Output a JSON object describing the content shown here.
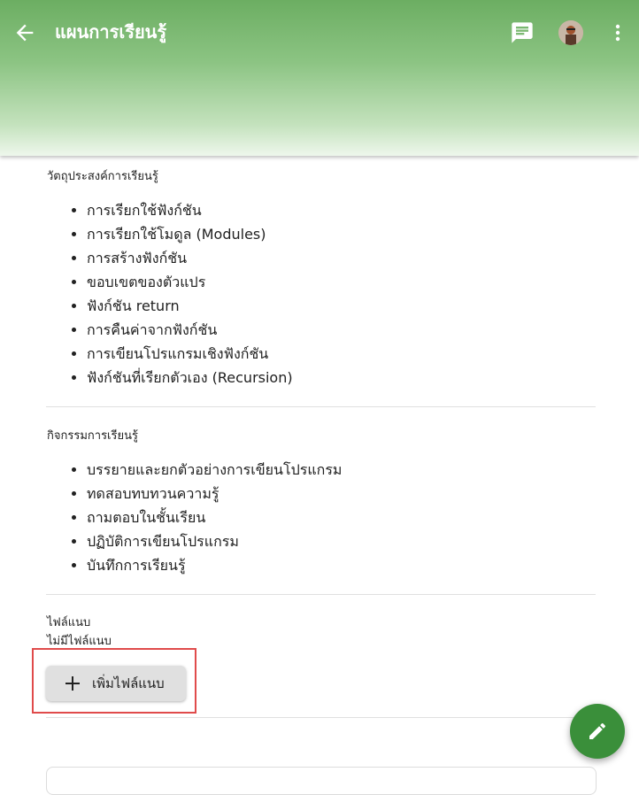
{
  "header": {
    "title": "แผนการเรียนรู้",
    "back_icon": "arrow-back-icon",
    "chat_icon": "chat-icon",
    "more_icon": "more-vert-icon",
    "gradient_top": "#6cae62",
    "gradient_bottom": "#eef7ec"
  },
  "objectives": {
    "label": "วัตถุประสงค์การเรียนรู้",
    "items": [
      "การเรียกใช้ฟังก์ชัน",
      "การเรียกใช้โมดูล (Modules)",
      "การสร้างฟังก์ชัน",
      "ขอบเขตของตัวแปร",
      "ฟังก์ชัน return",
      "การคืนค่าจากฟังก์ชัน",
      "การเขียนโปรแกรมเชิงฟังก์ชัน",
      "ฟังก์ชันที่เรียกตัวเอง (Recursion)"
    ]
  },
  "activities": {
    "label": "กิจกรรมการเรียนรู้",
    "items": [
      "บรรยายและยกตัวอย่างการเขียนโปรแกรม",
      "ทดสอบทบทวนความรู้",
      "ถามตอบในชั้นเรียน",
      "ปฏิบัติการเขียนโปรแกรม",
      "บันทึกการเรียนรู้"
    ]
  },
  "attachments": {
    "label": "ไฟล์แนบ",
    "empty_text": "ไม่มีไฟล์แนบ",
    "add_button_label": "เพิ่มไฟล์แนบ",
    "add_icon": "plus-icon"
  },
  "fab": {
    "icon": "pencil-icon",
    "color": "#3a8f3a"
  },
  "highlight_color": "#e04b4b"
}
